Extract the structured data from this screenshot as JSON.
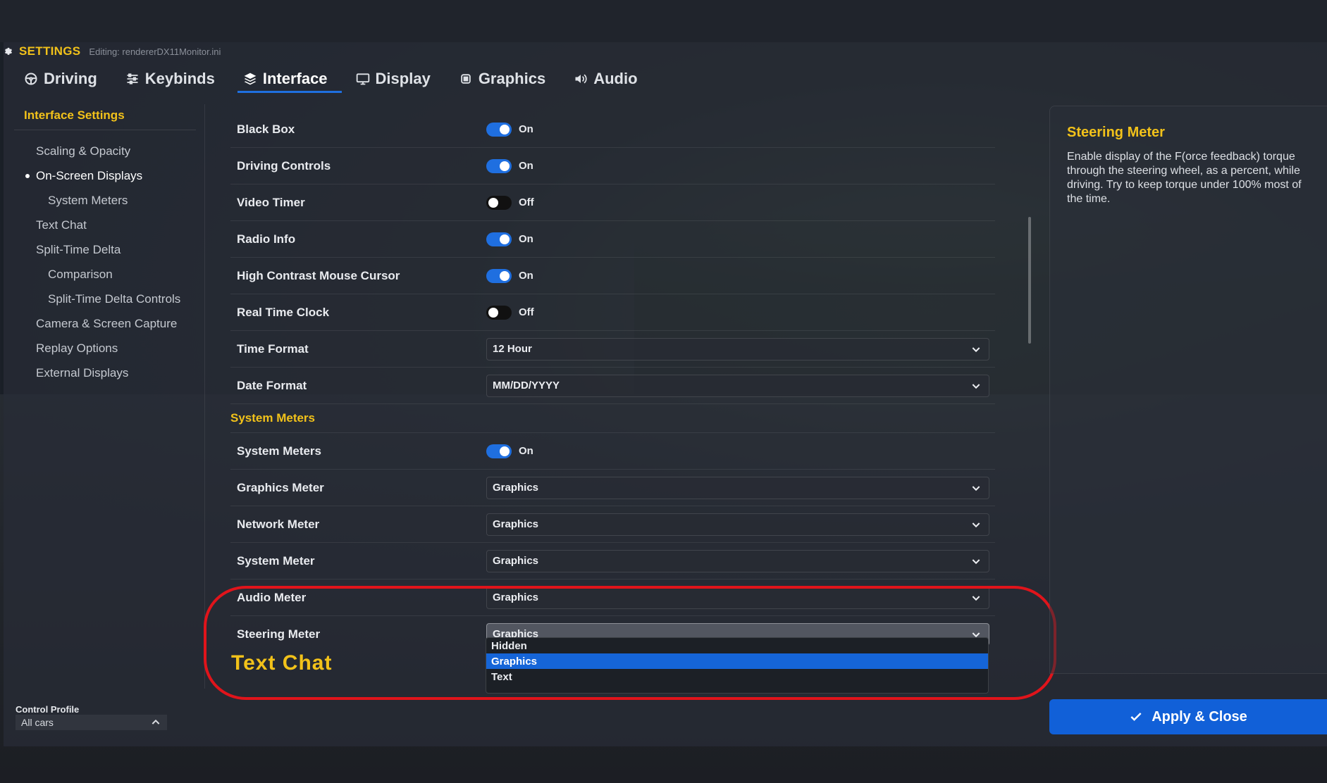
{
  "header": {
    "title": "SETTINGS",
    "editing": "Editing: rendererDX11Monitor.ini"
  },
  "tabs": [
    {
      "label": "Driving",
      "icon": "steering-wheel-icon"
    },
    {
      "label": "Keybinds",
      "icon": "sliders-icon"
    },
    {
      "label": "Interface",
      "icon": "layers-icon",
      "active": true
    },
    {
      "label": "Display",
      "icon": "monitor-icon"
    },
    {
      "label": "Graphics",
      "icon": "chip-icon"
    },
    {
      "label": "Audio",
      "icon": "speaker-icon"
    }
  ],
  "sidebar": {
    "heading": "Interface Settings",
    "items": [
      {
        "label": "Scaling & Opacity"
      },
      {
        "label": "On-Screen Displays",
        "active": true
      },
      {
        "label": "System Meters",
        "sub": true
      },
      {
        "label": "Text Chat"
      },
      {
        "label": "Split-Time Delta"
      },
      {
        "label": "Comparison",
        "sub": true
      },
      {
        "label": "Split-Time Delta Controls",
        "sub": true
      },
      {
        "label": "Camera & Screen Capture"
      },
      {
        "label": "Replay Options"
      },
      {
        "label": "External Displays"
      }
    ]
  },
  "settings": {
    "black_box": {
      "label": "Black Box",
      "state": "On"
    },
    "driving_controls": {
      "label": "Driving Controls",
      "state": "On"
    },
    "video_timer": {
      "label": "Video Timer",
      "state": "Off"
    },
    "radio_info": {
      "label": "Radio Info",
      "state": "On"
    },
    "high_contrast": {
      "label": "High Contrast Mouse Cursor",
      "state": "On"
    },
    "real_time_clock": {
      "label": "Real Time Clock",
      "state": "Off"
    },
    "time_format": {
      "label": "Time Format",
      "value": "12 Hour"
    },
    "date_format": {
      "label": "Date Format",
      "value": "MM/DD/YYYY"
    },
    "system_meters_section": "System Meters",
    "system_meters": {
      "label": "System Meters",
      "state": "On"
    },
    "graphics_meter": {
      "label": "Graphics Meter",
      "value": "Graphics"
    },
    "network_meter": {
      "label": "Network Meter",
      "value": "Graphics"
    },
    "system_meter": {
      "label": "System Meter",
      "value": "Graphics"
    },
    "audio_meter": {
      "label": "Audio Meter",
      "value": "Graphics"
    },
    "steering_meter": {
      "label": "Steering Meter",
      "value": "Graphics"
    },
    "text_chat_section": "Text Chat"
  },
  "dropdown": {
    "options": [
      "Hidden",
      "Graphics",
      "Text"
    ],
    "selected": "Graphics"
  },
  "info": {
    "title": "Steering Meter",
    "body": "Enable display of the F(orce feedback) torque through the steering wheel, as a percent, while driving. Try to keep torque under 100% most of the time."
  },
  "apply_label": "Apply & Close",
  "profile": {
    "label": "Control Profile",
    "value": "All cars"
  },
  "colors": {
    "accent": "#f2c21a",
    "toggle_on": "#1f6fe0",
    "apply": "#1160d8",
    "annotation": "#e0141b"
  }
}
